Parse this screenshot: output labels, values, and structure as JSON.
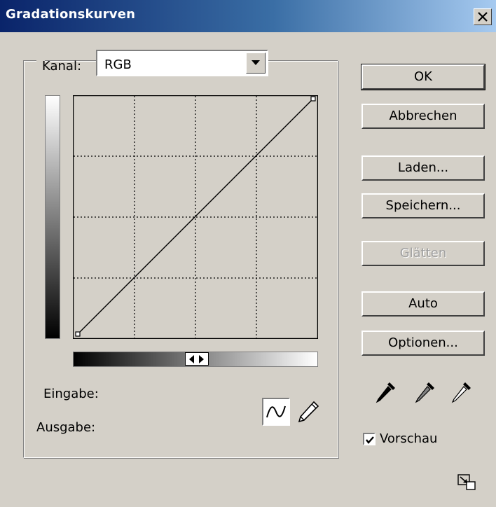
{
  "window": {
    "title": "Gradationskurven",
    "close_icon": "close-icon"
  },
  "channel": {
    "label": "Kanal:",
    "selected": "RGB",
    "dropdown_icon": "chevron-down-icon"
  },
  "curve": {
    "points": [
      [
        0,
        0
      ],
      [
        255,
        255
      ]
    ],
    "grid_divisions": 4
  },
  "fields": {
    "input_label": "Eingabe:",
    "output_label": "Ausgabe:"
  },
  "buttons": {
    "ok": "OK",
    "cancel": "Abbrechen",
    "load": "Laden...",
    "save": "Speichern...",
    "smooth": "Glätten",
    "auto": "Auto",
    "options": "Optionen..."
  },
  "tools": {
    "curve_tool": "curve-tool-icon",
    "pencil_tool": "pencil-icon",
    "eyedroppers": [
      "black-eyedropper-icon",
      "gray-eyedropper-icon",
      "white-eyedropper-icon"
    ]
  },
  "preview": {
    "label": "Vorschau",
    "checked": true
  },
  "colors": {
    "titlebar_start": "#0a246a",
    "titlebar_end": "#a6caf0",
    "dialog_bg": "#d4d0c8",
    "disabled_text": "#a0a0a0"
  }
}
